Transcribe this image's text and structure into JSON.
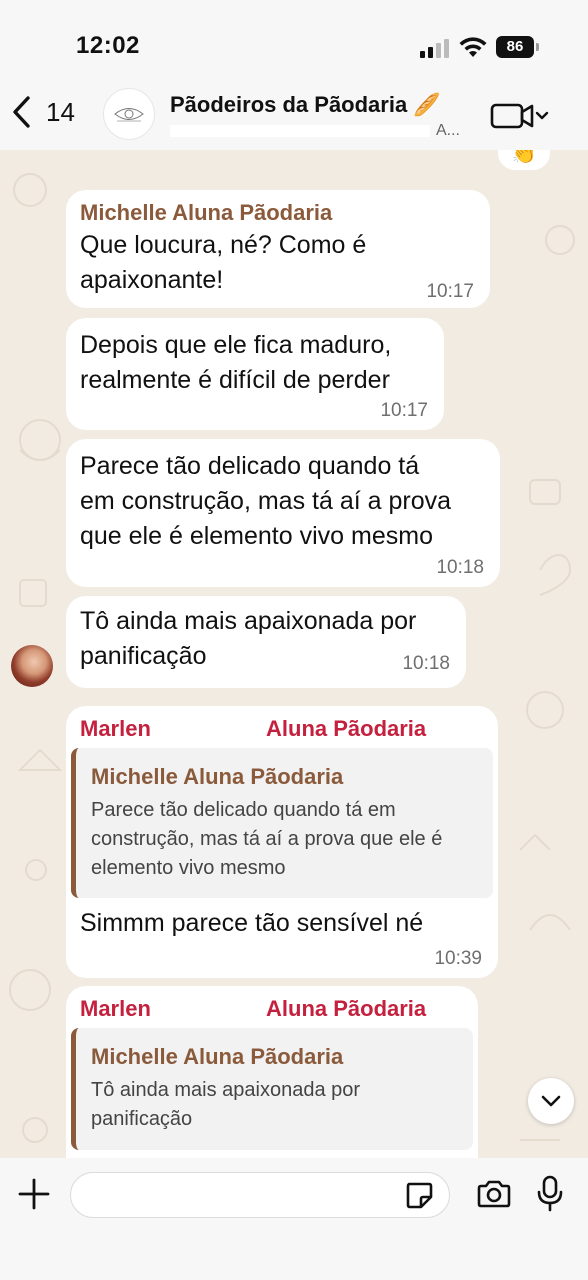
{
  "status_bar": {
    "time": "12:02",
    "battery": "86"
  },
  "header": {
    "back_count": "14",
    "group_name": "Pãodeiros da Pãodaria 🥖",
    "subtitle_tail": "A..."
  },
  "reaction_peek": "👏",
  "messages": [
    {
      "sender": "Michelle Aluna Pãodaria",
      "lines": [
        "Que loucura, né? Como é",
        "apaixonante!"
      ],
      "time": "10:17"
    },
    {
      "lines": [
        "Depois que ele fica maduro,",
        "realmente é difícil de perder"
      ],
      "time": "10:17"
    },
    {
      "lines": [
        "Parece tão delicado quando tá",
        "em construção, mas tá aí a prova",
        "que ele é elemento vivo mesmo"
      ],
      "time": "10:18"
    },
    {
      "lines": [
        "Tô ainda mais apaixonada por",
        "panificação"
      ],
      "time": "10:18"
    },
    {
      "sender_start": "Marlen",
      "sender_end": "Aluna Pãodaria",
      "quote_sender": "Michelle Aluna Pãodaria",
      "quote_lines": [
        "Parece tão delicado quando tá em",
        "construção, mas tá aí a prova que ele é",
        "elemento vivo mesmo"
      ],
      "text": "Simmm parece tão sensível né",
      "time": "10:39"
    },
    {
      "sender_start": "Marlen",
      "sender_end": "Aluna Pãodaria",
      "quote_sender": "Michelle Aluna Pãodaria",
      "quote_lines": [
        "Tô ainda mais apaixonada por",
        "panificação"
      ]
    }
  ],
  "input": {
    "placeholder": ""
  },
  "colors": {
    "sender_brown": "#8a5a3b",
    "sender_red": "#c4213f",
    "wallpaper": "#f1ebe2"
  },
  "icons": [
    "back-chevron-icon",
    "video-call-icon",
    "chevron-down-icon",
    "plus-icon",
    "sticker-icon",
    "camera-icon",
    "mic-icon",
    "scroll-down-icon"
  ]
}
